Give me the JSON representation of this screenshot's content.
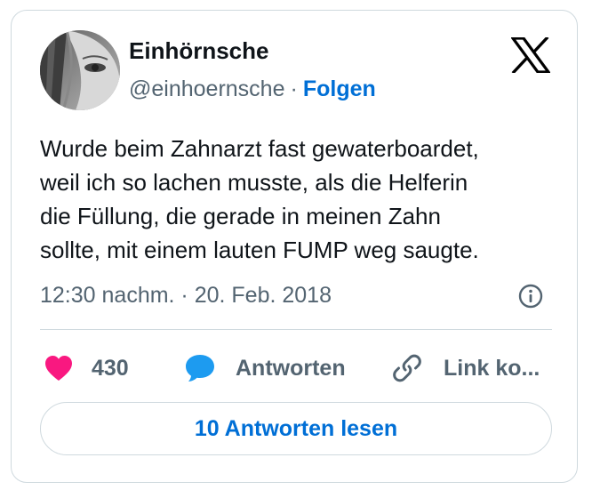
{
  "author": {
    "display_name": "Einhörnsche",
    "handle": "@einhoernsche",
    "separator": "·",
    "follow_label": "Folgen"
  },
  "tweet": {
    "text": "Wurde beim Zahnarzt fast gewaterboardet,\nweil ich so lachen musste, als die Helferin\ndie Füllung, die gerade in meinen Zahn\nsollte, mit einem lauten FUMP weg saugte.",
    "timestamp": "12:30 nachm. · 20. Feb. 2018"
  },
  "actions": {
    "like_count": "430",
    "reply_label": "Antworten",
    "copy_link_label": "Link ko..."
  },
  "read_replies_label": "10 Antworten lesen",
  "icons": {
    "brand": "x-logo-icon",
    "info": "info-icon",
    "like": "heart-icon",
    "reply": "speech-bubble-icon",
    "copy": "link-icon"
  },
  "colors": {
    "link_blue": "#006fd6",
    "heart": "#f91880",
    "reply_bubble": "#1d9bf0",
    "secondary_text": "#536471",
    "border": "#cfd9de"
  }
}
